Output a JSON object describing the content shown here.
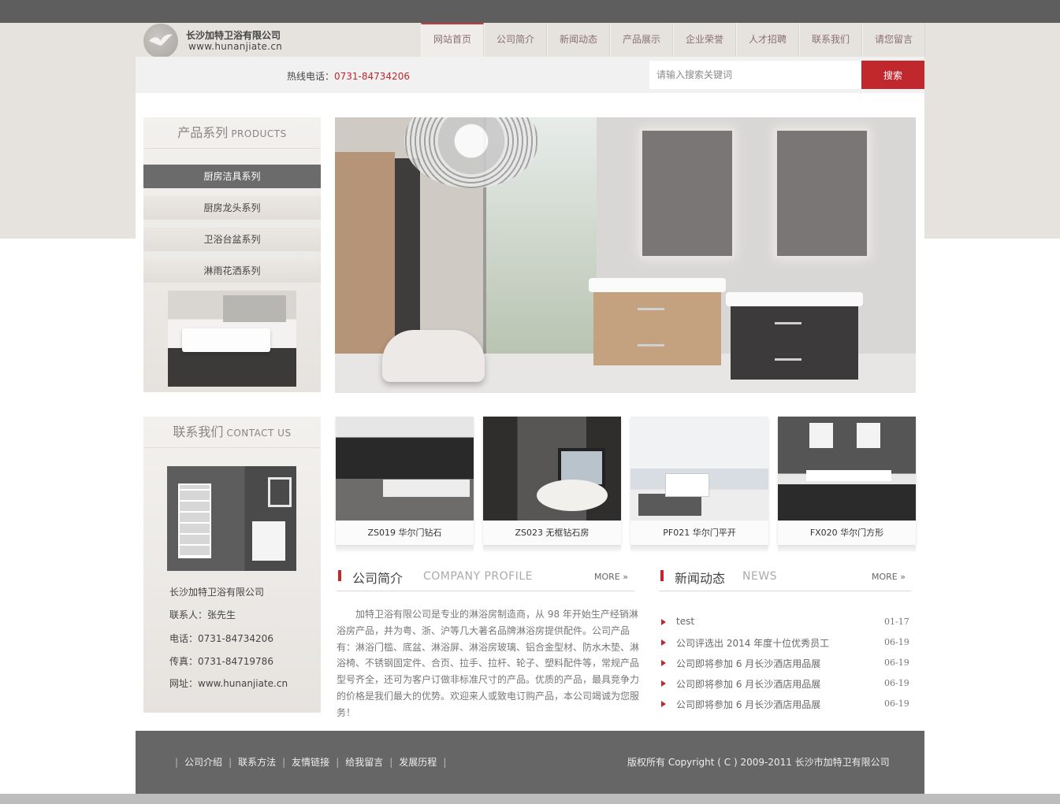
{
  "header": {
    "company_name": "长沙加特卫浴有限公司",
    "url": "www.hunanjiate.cn",
    "nav": [
      "网站首页",
      "公司简介",
      "新闻动态",
      "产品展示",
      "企业荣誉",
      "人才招聘",
      "联系我们",
      "请您留言"
    ],
    "active_nav": "网站首页"
  },
  "search": {
    "hotline_label": "热线电话：",
    "hotline_number": "0731-84734206",
    "placeholder": "请输入搜索关键词",
    "button": "搜索"
  },
  "products_panel": {
    "title_cn": "产品系列",
    "title_en": "PRODUCTS",
    "categories": [
      "厨房洁具系列",
      "厨房龙头系列",
      "卫浴台盆系列",
      "淋雨花洒系列"
    ],
    "active_category": "厨房洁具系列"
  },
  "contact_panel": {
    "title_cn": "联系我们",
    "title_en": "CONTACT US",
    "company": "长沙加特卫浴有限公司",
    "contact_person": "联系人：张先生",
    "phone": "电话：0731-84734206",
    "fax": "传真：0731-84719786",
    "website": "网址：www.hunanjiate.cn"
  },
  "products": [
    {
      "name": "ZS019 华尔门钻石"
    },
    {
      "name": "ZS023 无框钻石房"
    },
    {
      "name": "PF021 华尔门平开"
    },
    {
      "name": "FX020 华尔门方形"
    }
  ],
  "about": {
    "title_cn": "公司简介",
    "title_en": "COMPANY PROFILE",
    "more": "MORE",
    "text": "加特卫浴有限公司是专业的淋浴房制造商，从 98 年开始生产经销淋浴房产品，并为粤、浙、沪等几大著名品牌淋浴房提供配件。公司产品有：淋浴门槛、底盆、淋浴屏、淋浴房玻璃、铝合金型材、防水木垫、淋浴椅、不锈钢固定件、合页、拉手、拉杆、轮子、塑料配件等，常规产品型号齐全，还可为客户订做非标准尺寸的产品。优质的产品，最具竞争力的价格是我们最大的优势。欢迎来人或致电订购产品，本公司竭诚为您服务！"
  },
  "news": {
    "title_cn": "新闻动态",
    "title_en": "NEWS",
    "more": "MORE",
    "items": [
      {
        "title": "test",
        "date": "01-17"
      },
      {
        "title": "公司评选出 2014 年度十位优秀员工",
        "date": "06-19"
      },
      {
        "title": "公司即将参加 6 月长沙酒店用品展",
        "date": "06-19"
      },
      {
        "title": "公司即将参加 6 月长沙酒店用品展",
        "date": "06-19"
      },
      {
        "title": "公司即将参加 6 月长沙酒店用品展",
        "date": "06-19"
      }
    ]
  },
  "footer": {
    "links": [
      "公司介绍",
      "联系方法",
      "友情链接",
      "给我留言",
      "发展历程"
    ],
    "copyright": "版权所有 Copyright ( C ) 2009-2011 长沙市加特卫有限公司"
  },
  "colors": {
    "accent": "#c0282d",
    "top_bar": "#5e5e5e",
    "footer": "#666666",
    "band": "#e6e3df"
  }
}
